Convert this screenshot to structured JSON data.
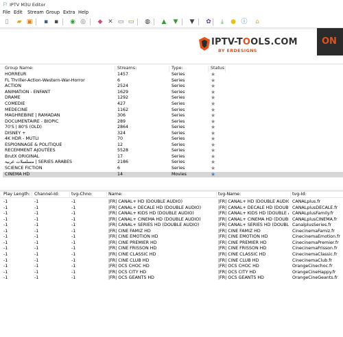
{
  "window": {
    "title": "IPTV M3U Editor"
  },
  "menu": [
    "File",
    "Edit",
    "Stream",
    "Group",
    "Extra",
    "Help"
  ],
  "toolbar_icons": [
    {
      "name": "new-file-icon",
      "glyph": "▯",
      "color": "#8a8a8a"
    },
    {
      "name": "open-folder-icon",
      "glyph": "▰",
      "color": "#e3a22a"
    },
    {
      "name": "open-url-icon",
      "glyph": "▣",
      "color": "#e07a1f"
    },
    {
      "name": "save-icon",
      "glyph": "▪",
      "color": "#2d5fa8"
    },
    {
      "name": "save-as-icon",
      "glyph": "▪",
      "color": "#4a4a4a"
    },
    {
      "name": "refresh-icon",
      "glyph": "◉",
      "color": "#3a9a3a"
    },
    {
      "name": "settings-icon",
      "glyph": "◎",
      "color": "#6a6a6a"
    },
    {
      "name": "eraser-icon",
      "glyph": "◆",
      "color": "#d04a6a"
    },
    {
      "name": "cut-icon",
      "glyph": "✕",
      "color": "#555555"
    },
    {
      "name": "copy-icon",
      "glyph": "▭",
      "color": "#666666"
    },
    {
      "name": "paste-icon",
      "glyph": "▭",
      "color": "#8a6a3a"
    },
    {
      "name": "find-icon",
      "glyph": "◍",
      "color": "#333333"
    },
    {
      "name": "move-up-icon",
      "glyph": "▲",
      "color": "#3a9a3a"
    },
    {
      "name": "move-down-icon",
      "glyph": "▼",
      "color": "#3a9a3a"
    },
    {
      "name": "filter-icon",
      "glyph": "▼",
      "color": "#444444"
    },
    {
      "name": "gear-icon",
      "glyph": "✿",
      "color": "#6a3a9a"
    },
    {
      "name": "download-icon",
      "glyph": "⤓",
      "color": "#3a9a3a"
    },
    {
      "name": "bulb-icon",
      "glyph": "●",
      "color": "#e8c020"
    },
    {
      "name": "info-icon",
      "glyph": "ⓘ",
      "color": "#2d6fb8"
    },
    {
      "name": "home-icon",
      "glyph": "⌂",
      "color": "#e3a22a"
    }
  ],
  "banner": {
    "logo_text_pre": "IPTV-T",
    "logo_text_o": "O",
    "logo_text_post": "OLS.COM",
    "logo_sub": "BY ERDESIGNS",
    "side_text": "ON",
    "colors": {
      "accent": "#e0531b",
      "dark": "#2b2b2b"
    }
  },
  "groups": {
    "headers": {
      "name": "Group Name:",
      "streams": "Streams:",
      "type": "Type:",
      "status": "Status:"
    },
    "rows": [
      {
        "name": "HORREUR",
        "streams": "1457",
        "type": "Series",
        "status": "★"
      },
      {
        "name": "FL Thriller-Action-Western-War-Horror",
        "streams": "6",
        "type": "Series",
        "status": "★"
      },
      {
        "name": "ACTION",
        "streams": "2524",
        "type": "Series",
        "status": "★"
      },
      {
        "name": "ANIMATION - ENFANT",
        "streams": "1629",
        "type": "Series",
        "status": "★"
      },
      {
        "name": "DRAME",
        "streams": "1292",
        "type": "Series",
        "status": "★"
      },
      {
        "name": "COMEDIE",
        "streams": "427",
        "type": "Series",
        "status": "★"
      },
      {
        "name": "MEDECINE",
        "streams": "1162",
        "type": "Series",
        "status": "★"
      },
      {
        "name": "MAGHREBINE | RAMADAN",
        "streams": "306",
        "type": "Series",
        "status": "★"
      },
      {
        "name": "DOCUMENTAIRE - BIOPIC",
        "streams": "289",
        "type": "Series",
        "status": "★"
      },
      {
        "name": "70'S | 80'S (OLD)",
        "streams": "2864",
        "type": "Series",
        "status": "★"
      },
      {
        "name": "DISNEY +",
        "streams": "324",
        "type": "Series",
        "status": "★"
      },
      {
        "name": "4K HDR - MUTLI",
        "streams": "70",
        "type": "Series",
        "status": "★"
      },
      {
        "name": "ESPIONNAGE & POLITIQUE",
        "streams": "12",
        "type": "Series",
        "status": "★"
      },
      {
        "name": "RECEMMENT AJOUTÉES",
        "streams": "5528",
        "type": "Series",
        "status": "★"
      },
      {
        "name": "BrutX ORIGINAL",
        "streams": "17",
        "type": "Series",
        "status": "★"
      },
      {
        "name": "مسلسلات عربية | SERIES ARABES",
        "streams": "2186",
        "type": "Series",
        "status": "★"
      },
      {
        "name": "SCIENCE FICTION",
        "streams": "6",
        "type": "Series",
        "status": "★"
      },
      {
        "name": "CINEMA HD",
        "streams": "14",
        "type": "Movies",
        "status": "★",
        "selected": true
      }
    ]
  },
  "channels": {
    "headers": {
      "play_length": "Play Length:",
      "channel_id": "Channel-Id:",
      "tvg_chno": "tvg-Chno:",
      "name": "Name:",
      "tvg_name": "tvg-Name:",
      "tvg_id": "tvg-Id:"
    },
    "rows": [
      {
        "play_length": "-1",
        "channel_id": "-1",
        "tvg_chno": "-1",
        "name": "|FR| CANAL+ HD (DOUBLE AUDIO)",
        "tvg_name": "|FR| CANAL+ HD (DOUBLE AUDIO)",
        "tvg_id": "CANALplus.fr"
      },
      {
        "play_length": "-1",
        "channel_id": "-1",
        "tvg_chno": "-1",
        "name": "|FR| CANAL+ DECALE HD (DOUBLE AUDIO)",
        "tvg_name": "|FR| CANAL+ DECALE HD (DOUBLE ...",
        "tvg_id": "CANALplusDECALE.fr"
      },
      {
        "play_length": "-1",
        "channel_id": "-1",
        "tvg_chno": "-1",
        "name": "|FR| CANAL+ KIDS HD (DOUBLE AUDIO)",
        "tvg_name": "|FR| CANAL+ KIDS HD (DOUBLE AU...",
        "tvg_id": "CANALplusFamily.fr"
      },
      {
        "play_length": "-1",
        "channel_id": "-1",
        "tvg_chno": "-1",
        "name": "|FR| CANAL+ CINEMA HD (DOUBLE AUDIO)",
        "tvg_name": "|FR| CANAL+ CINEMA HD (DOUBLE...",
        "tvg_id": "CANALplusCINEMA.fr"
      },
      {
        "play_length": "-1",
        "channel_id": "-1",
        "tvg_chno": "-1",
        "name": "|FR| CANAL+ SERIES HD (DOUBLE AUDIO)",
        "tvg_name": "|FR| CANAL+ SERIES HD (DOUBLE A...",
        "tvg_id": "CanalplusSeries.fr"
      },
      {
        "play_length": "-1",
        "channel_id": "-1",
        "tvg_chno": "-1",
        "name": "|FR| CINE FAMIZ HD",
        "tvg_name": "|FR| CINE FAMIZ HD",
        "tvg_id": "CinecinemaFamiz.fr"
      },
      {
        "play_length": "-1",
        "channel_id": "-1",
        "tvg_chno": "-1",
        "name": "|FR| CINE EMOTION HD",
        "tvg_name": "|FR| CINE EMOTION HD",
        "tvg_id": "CinecinemaEmotion.fr"
      },
      {
        "play_length": "-1",
        "channel_id": "-1",
        "tvg_chno": "-1",
        "name": "|FR| CINE PREMIER HD",
        "tvg_name": "|FR| CINE PREMIER HD",
        "tvg_id": "CinecinemaPremier.fr"
      },
      {
        "play_length": "-1",
        "channel_id": "-1",
        "tvg_chno": "-1",
        "name": "|FR| CINE FRISSON HD",
        "tvg_name": "|FR| CINE FRISSON HD",
        "tvg_id": "CinecinemaFrisson.fr"
      },
      {
        "play_length": "-1",
        "channel_id": "-1",
        "tvg_chno": "-1",
        "name": "|FR| CINE CLASSIC HD",
        "tvg_name": "|FR| CINE CLASSIC HD",
        "tvg_id": "CinecinemaClassic.fr"
      },
      {
        "play_length": "-1",
        "channel_id": "-1",
        "tvg_chno": "-1",
        "name": "|FR| CINE CLUB HD",
        "tvg_name": "|FR| CINE CLUB HD",
        "tvg_id": "CinecinemaClub.fr"
      },
      {
        "play_length": "-1",
        "channel_id": "-1",
        "tvg_chno": "-1",
        "name": "|FR| OCS CHOC HD",
        "tvg_name": "|FR| OCS CHOC HD",
        "tvg_id": "OrangeCinechoc.fr"
      },
      {
        "play_length": "-1",
        "channel_id": "-1",
        "tvg_chno": "-1",
        "name": "|FR| OCS CITY HD",
        "tvg_name": "|FR| OCS CITY HD",
        "tvg_id": "OrangeCineHappy.fr"
      },
      {
        "play_length": "-1",
        "channel_id": "-1",
        "tvg_chno": "-1",
        "name": "|FR| OCS GEANTS HD",
        "tvg_name": "|FR| OCS GEANTS HD",
        "tvg_id": "OrangeCineGeants.fr"
      }
    ]
  }
}
